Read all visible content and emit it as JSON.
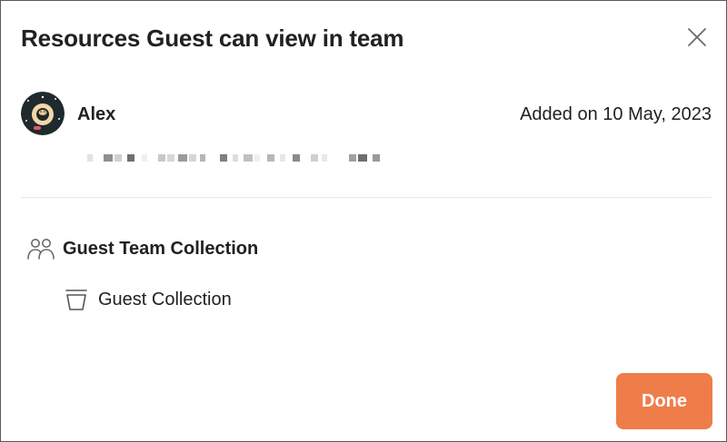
{
  "dialog": {
    "title": "Resources Guest can view in team",
    "close_icon": "close-icon"
  },
  "user": {
    "name": "Alex",
    "added_text": "Added on 10 May, 2023",
    "avatar_icon": "avatar",
    "email_redacted": true
  },
  "resources": {
    "team": {
      "icon": "team-icon",
      "label": "Guest Team Collection"
    },
    "collections": [
      {
        "icon": "collection-icon",
        "label": "Guest Collection"
      }
    ]
  },
  "footer": {
    "done_label": "Done"
  },
  "colors": {
    "accent": "#ef7d4a",
    "text": "#212121",
    "divider": "#e6e6e6",
    "avatar_bg": "#1f2a2e",
    "avatar_ring": "#f3d7a8"
  }
}
